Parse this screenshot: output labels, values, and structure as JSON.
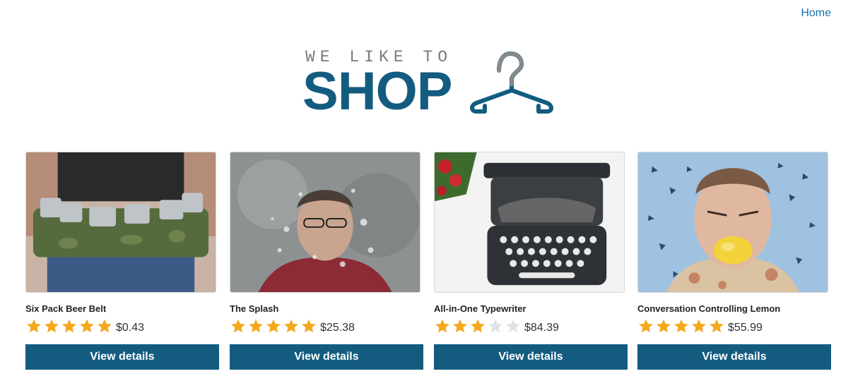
{
  "nav": {
    "home_label": "Home"
  },
  "logo": {
    "tagline": "WE LIKE TO",
    "word": "SHOP",
    "icon": "hanger-icon"
  },
  "colors": {
    "brand": "#135c80",
    "link": "#1873b0",
    "star_filled": "#f4a81c",
    "star_empty": "#dde3e7"
  },
  "products": [
    {
      "title": "Six Pack Beer Belt",
      "rating": 5,
      "price": "$0.43",
      "button_label": "View details",
      "image": "beer-belt-photo"
    },
    {
      "title": "The Splash",
      "rating": 5,
      "price": "$25.38",
      "button_label": "View details",
      "image": "splash-photo"
    },
    {
      "title": "All-in-One Typewriter",
      "rating": 3,
      "price": "$84.39",
      "button_label": "View details",
      "image": "typewriter-photo"
    },
    {
      "title": "Conversation Controlling Lemon",
      "rating": 5,
      "price": "$55.99",
      "button_label": "View details",
      "image": "lemon-photo"
    }
  ]
}
